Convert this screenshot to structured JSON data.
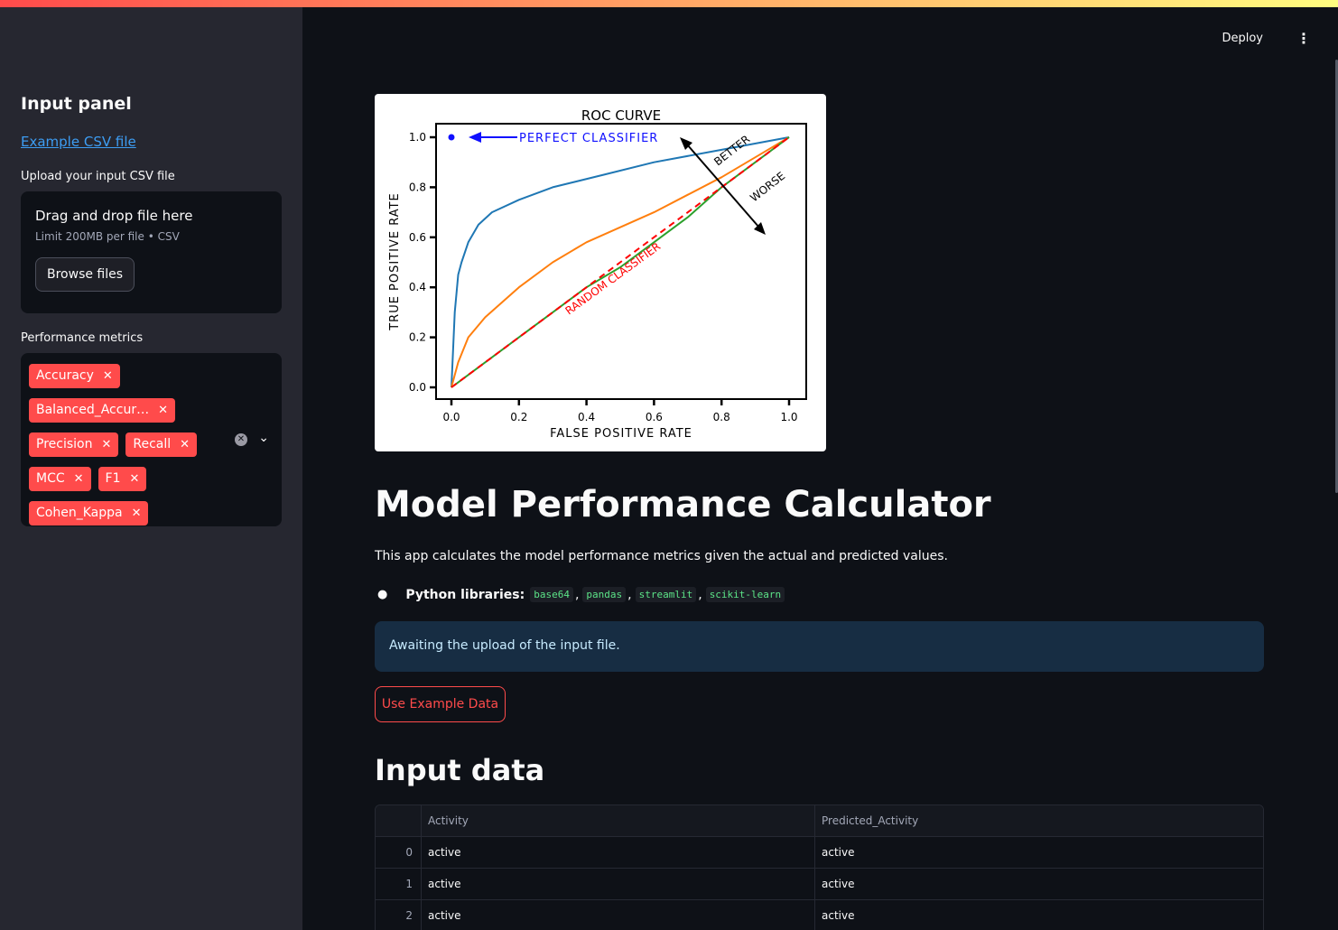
{
  "sidebar": {
    "title": "Input panel",
    "example_link": "Example CSV file",
    "upload_label": "Upload your input CSV file",
    "uploader": {
      "title": "Drag and drop file here",
      "limit": "Limit 200MB per file • CSV",
      "browse_label": "Browse files"
    },
    "metrics_label": "Performance metrics",
    "metrics": {
      "chips": [
        "Accuracy",
        "Balanced_Accur…",
        "Precision",
        "Recall",
        "MCC",
        "F1",
        "Cohen_Kappa"
      ],
      "clear_icon": "clear-circle-icon",
      "caret_icon": "chevron-down-icon"
    }
  },
  "header": {
    "deploy_label": "Deploy",
    "menu_icon": "vertical-ellipsis-icon"
  },
  "main": {
    "title": "Model Performance Calculator",
    "description": "This app calculates the model performance metrics given the actual and predicted values.",
    "libraries_label": "Python libraries:",
    "libraries": [
      "base64",
      "pandas",
      "streamlit",
      "scikit-learn"
    ],
    "info": "Awaiting the upload of the input file.",
    "example_button": "Use Example Data",
    "input_heading": "Input data",
    "table": {
      "columns": [
        "",
        "Activity",
        "Predicted_Activity"
      ],
      "rows": [
        [
          "0",
          "active",
          "active"
        ],
        [
          "1",
          "active",
          "active"
        ],
        [
          "2",
          "active",
          "active"
        ]
      ]
    }
  },
  "chart_data": {
    "type": "line",
    "title": "ROC CURVE",
    "xlabel": "FALSE POSITIVE RATE",
    "ylabel": "TRUE POSITIVE RATE",
    "xlim": [
      0,
      1
    ],
    "ylim": [
      0,
      1
    ],
    "xticks": [
      "0.0",
      "0.2",
      "0.4",
      "0.6",
      "0.8",
      "1.0"
    ],
    "yticks": [
      "0.0",
      "0.2",
      "0.4",
      "0.6",
      "0.8",
      "1.0"
    ],
    "series": [
      {
        "color": "#1f77b4",
        "x": [
          0,
          0.01,
          0.02,
          0.03,
          0.05,
          0.08,
          0.12,
          0.2,
          0.3,
          0.45,
          0.6,
          0.8,
          1.0
        ],
        "y": [
          0,
          0.3,
          0.45,
          0.5,
          0.58,
          0.65,
          0.7,
          0.75,
          0.8,
          0.85,
          0.9,
          0.95,
          1.0
        ]
      },
      {
        "color": "#ff7f0e",
        "x": [
          0,
          0.02,
          0.05,
          0.1,
          0.2,
          0.3,
          0.4,
          0.5,
          0.6,
          0.7,
          0.8,
          0.9,
          1.0
        ],
        "y": [
          0,
          0.1,
          0.2,
          0.28,
          0.4,
          0.5,
          0.58,
          0.64,
          0.7,
          0.77,
          0.84,
          0.92,
          1.0
        ]
      },
      {
        "color": "#2ca02c",
        "x": [
          0,
          0.1,
          0.2,
          0.3,
          0.4,
          0.5,
          0.6,
          0.7,
          0.8,
          0.9,
          1.0
        ],
        "y": [
          0,
          0.1,
          0.2,
          0.3,
          0.4,
          0.48,
          0.58,
          0.68,
          0.8,
          0.9,
          1.0
        ]
      },
      {
        "color": "#ff0000",
        "dashed": true,
        "x": [
          0,
          1
        ],
        "y": [
          0,
          1
        ]
      }
    ],
    "annotations": [
      {
        "text": "PERFECT CLASSIFIER",
        "color": "#1010ff",
        "point": [
          0,
          1
        ]
      },
      {
        "text": "BETTER",
        "color": "#000000"
      },
      {
        "text": "WORSE",
        "color": "#000000"
      },
      {
        "text": "RANDOM CLASSIFIER",
        "color": "#ff0000"
      }
    ]
  }
}
